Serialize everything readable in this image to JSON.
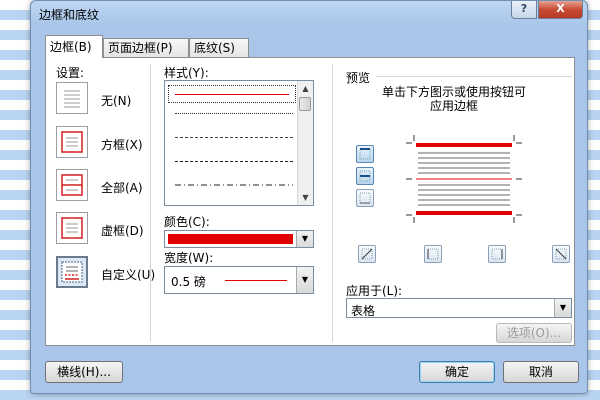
{
  "dialog": {
    "title": "边框和底纹",
    "help_label": "?",
    "close_label": "X"
  },
  "tabs": [
    {
      "label": "边框(B)",
      "active": true
    },
    {
      "label": "页面边框(P)",
      "active": false
    },
    {
      "label": "底纹(S)",
      "active": false
    }
  ],
  "settings": {
    "label": "设置:",
    "items": [
      {
        "label": "无(N)",
        "icon": "no-border-icon"
      },
      {
        "label": "方框(X)",
        "icon": "box-border-icon"
      },
      {
        "label": "全部(A)",
        "icon": "all-borders-icon"
      },
      {
        "label": "虚框(D)",
        "icon": "grid-border-icon"
      },
      {
        "label": "自定义(U)",
        "icon": "custom-border-icon",
        "selected": true
      }
    ]
  },
  "style": {
    "label": "样式(Y):",
    "options": [
      "solid",
      "dotted",
      "dashed-fine",
      "dashed",
      "dash-dot"
    ]
  },
  "color": {
    "label": "颜色(C):",
    "value": "#ff0000"
  },
  "width": {
    "label": "宽度(W):",
    "value": "0.5 磅"
  },
  "preview": {
    "label": "预览",
    "hint_line1": "单击下方图示或使用按钮可",
    "hint_line2": "应用边框"
  },
  "apply_to": {
    "label": "应用于(L):",
    "value": "表格"
  },
  "buttons": {
    "options": "选项(O)...",
    "horizontal_line": "横线(H)...",
    "ok": "确定",
    "cancel": "取消"
  },
  "colors": {
    "accent_red": "#e00000",
    "title_bar": "#bed6f2"
  }
}
